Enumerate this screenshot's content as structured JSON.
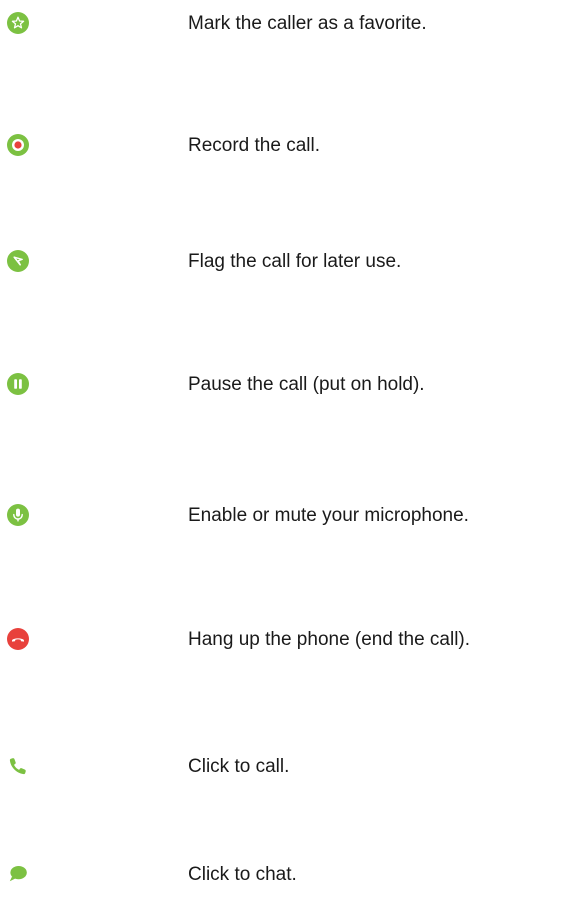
{
  "legend": {
    "items": [
      {
        "icon": "favorite-star-icon",
        "label": "Mark the caller as a favorite."
      },
      {
        "icon": "record-icon",
        "label": "Record the call."
      },
      {
        "icon": "flag-icon",
        "label": "Flag the call for later use."
      },
      {
        "icon": "pause-icon",
        "label": "Pause the call (put on hold)."
      },
      {
        "icon": "microphone-icon",
        "label": "Enable or mute your microphone."
      },
      {
        "icon": "hang-up-icon",
        "label": "Hang up the phone (end the call)."
      },
      {
        "icon": "phone-icon",
        "label": "Click to call."
      },
      {
        "icon": "chat-bubble-icon",
        "label": "Click to chat."
      }
    ]
  },
  "colors": {
    "green": "#7cc142",
    "green_dark": "#5e9e2c",
    "red": "#e8413c",
    "record_dot": "#e8413c",
    "text": "#1a1a1a"
  }
}
